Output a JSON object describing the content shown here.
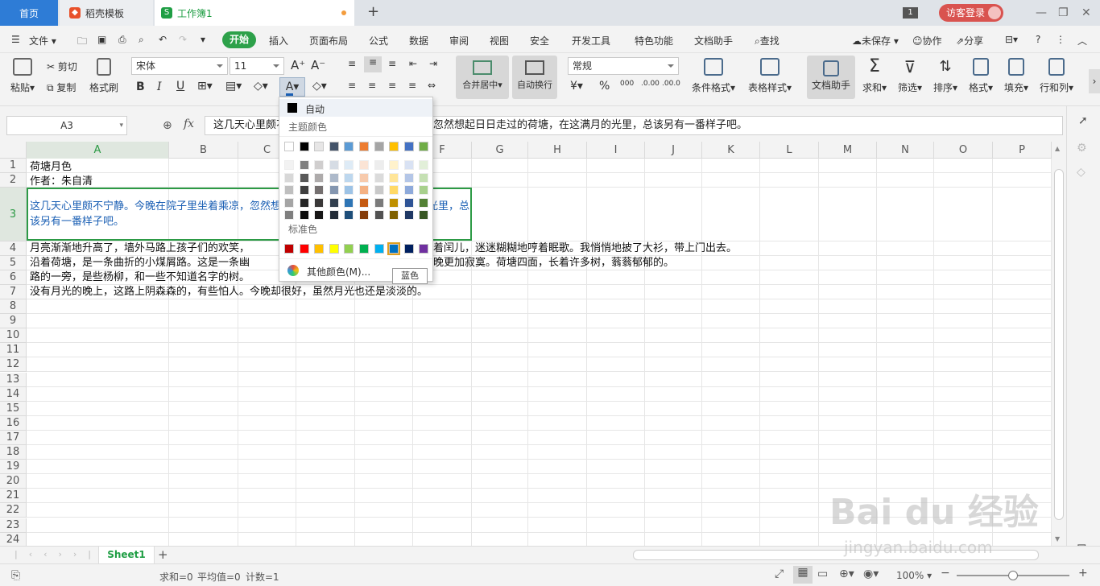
{
  "tabs": {
    "home": "首页",
    "template": "稻壳模板",
    "workbook": "工作簿1",
    "add": "+",
    "badge": "1",
    "login": "访客登录"
  },
  "menu": {
    "file": "文件",
    "items": [
      "开始",
      "插入",
      "页面布局",
      "公式",
      "数据",
      "审阅",
      "视图",
      "安全",
      "开发工具",
      "特色功能",
      "文档助手"
    ],
    "search": "查找",
    "unsaved": "未保存",
    "collab": "协作",
    "share": "分享"
  },
  "ribbon": {
    "paste": "粘贴",
    "cut": "剪切",
    "copy": "复制",
    "format_painter": "格式刷",
    "font": "宋体",
    "size": "11",
    "merge": "合并居中",
    "wrap": "自动换行",
    "numfmt": "常规",
    "cond": "条件格式",
    "table_style": "表格样式",
    "doc_helper": "文档助手",
    "sum": "求和",
    "filter": "筛选",
    "sort": "排序",
    "format": "格式",
    "fill": "填充",
    "rowcol": "行和列"
  },
  "formula": {
    "cell": "A3",
    "content": "这几天心里颇不宁静。今晚在院子里坐着乘凉，忽然想起日日走过的荷塘，在这满月的光里，总该另有一番样子吧。"
  },
  "columns": [
    "A",
    "B",
    "C",
    "D",
    "E",
    "F",
    "G",
    "H",
    "I",
    "J",
    "K",
    "L",
    "M",
    "N",
    "O",
    "P"
  ],
  "rows": [
    "1",
    "2",
    "3",
    "4",
    "5",
    "6",
    "7",
    "8",
    "9",
    "10",
    "11",
    "12",
    "13",
    "14",
    "15",
    "16",
    "17",
    "18",
    "19",
    "20",
    "21",
    "22",
    "23",
    "24"
  ],
  "cells": {
    "a1": "荷塘月色",
    "a2": "作者：朱自清",
    "a3": "这几天心里颇不宁静。今晚在院子里坐着乘凉，忽然想起日日走过的荷塘，在这满月的光里，总该另有一番样子吧。",
    "a4_left": "月亮渐渐地升高了，墙外马路上孩子们的欢笑，",
    "a4_right": "着闰儿，迷迷糊糊地哼着眠歌。我悄悄地披了大衫，带上门出去。",
    "a5_left": "沿着荷塘，是一条曲折的小煤屑路。这是一条幽",
    "a5_right": "晚更加寂寞。荷塘四面，长着许多树，蓊蓊郁郁的。",
    "a6": "路的一旁，是些杨柳，和一些不知道名字的树。",
    "a7": "没有月光的晚上，这路上阴森森的，有些怕人。今晚却很好，虽然月光也还是淡淡的。"
  },
  "popup": {
    "auto": "自动",
    "theme": "主题颜色",
    "standard": "标准色",
    "more": "其他颜色(M)...",
    "tooltip": "蓝色",
    "theme_top": [
      "#ffffff",
      "#000000",
      "#e7e6e6",
      "#44546a",
      "#5b9bd5",
      "#ed7d31",
      "#a5a5a5",
      "#ffc000",
      "#4472c4",
      "#70ad47"
    ],
    "theme_shades": [
      [
        "#f2f2f2",
        "#7f7f7f",
        "#d0cece",
        "#d6dce4",
        "#deebf6",
        "#fbe4d5",
        "#ededed",
        "#fff2cc",
        "#d9e2f3",
        "#e2efd9"
      ],
      [
        "#d8d8d8",
        "#595959",
        "#aeabab",
        "#adb9ca",
        "#bdd7ee",
        "#f7caac",
        "#dbdbdb",
        "#ffe598",
        "#b4c6e7",
        "#c5e0b3"
      ],
      [
        "#bfbfbf",
        "#3f3f3f",
        "#757070",
        "#8496b0",
        "#9dc3e6",
        "#f4b183",
        "#c9c9c9",
        "#ffd966",
        "#8eaadb",
        "#a8d08d"
      ],
      [
        "#a5a5a5",
        "#262626",
        "#3a3838",
        "#323f4f",
        "#2e75b5",
        "#c55a11",
        "#7b7b7b",
        "#bf9000",
        "#2f5496",
        "#538135"
      ],
      [
        "#7f7f7f",
        "#0c0c0c",
        "#171616",
        "#222a35",
        "#1e4e79",
        "#833c0b",
        "#525252",
        "#7f6000",
        "#1f3864",
        "#375623"
      ]
    ],
    "standard_colors": [
      "#c00000",
      "#ff0000",
      "#ffc000",
      "#ffff00",
      "#92d050",
      "#00b050",
      "#00b0f0",
      "#0070c0",
      "#002060",
      "#7030a0"
    ]
  },
  "sheet": "Sheet1",
  "status": {
    "sum": "求和=0",
    "avg": "平均值=0",
    "count": "计数=1",
    "zoom": "100%"
  },
  "watermark": "Bai du 经验",
  "watermark_url": "jingyan.baidu.com"
}
